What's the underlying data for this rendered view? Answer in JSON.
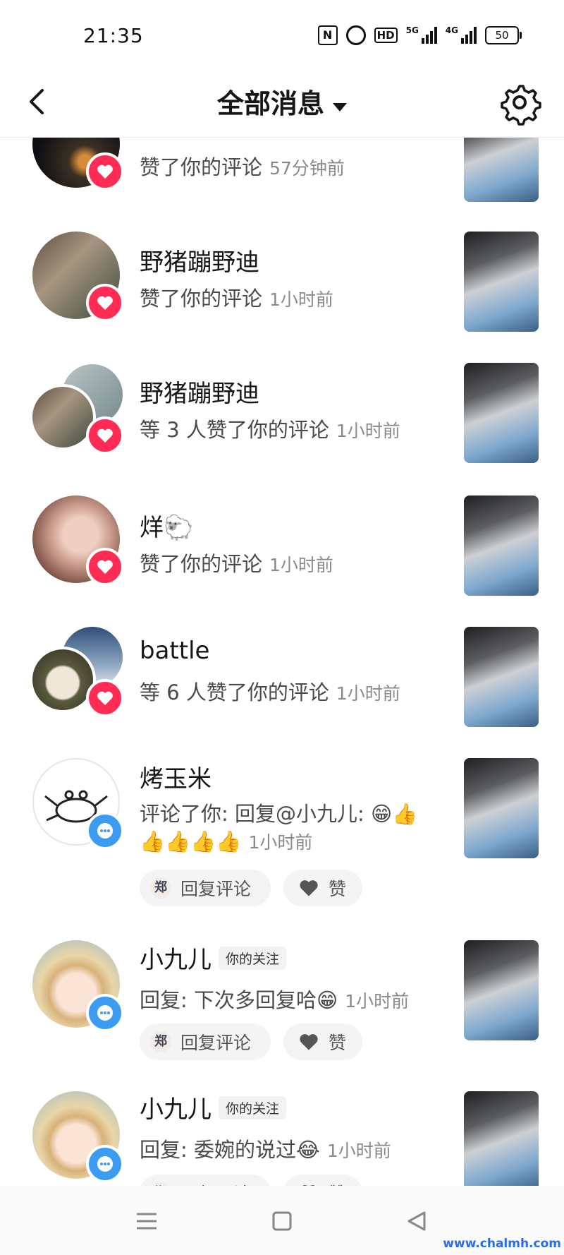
{
  "status_bar": {
    "time": "21:35",
    "hd": "HD",
    "net5g": "5G",
    "net4g": "4G",
    "battery": "50"
  },
  "header": {
    "title": "全部消息"
  },
  "items": [
    {
      "name": "",
      "desc": "赞了你的评论",
      "time": "57分钟前"
    },
    {
      "name": "野猪蹦野迪",
      "desc": "赞了你的评论",
      "time": "1小时前"
    },
    {
      "name": "野猪蹦野迪",
      "desc": "等 3 人赞了你的评论",
      "time": "1小时前"
    },
    {
      "name": "烊🐑",
      "desc": "赞了你的评论",
      "time": "1小时前"
    },
    {
      "name": "battle",
      "desc": "等 6 人赞了你的评论",
      "time": "1小时前"
    },
    {
      "name": "烤玉米",
      "desc_line1": "评论了你: 回复@小九儿: 😁👍",
      "desc_line2": "👍👍👍👍",
      "time": "1小时前"
    },
    {
      "name": "小九儿",
      "tag": "你的关注",
      "desc": "回复: 下次多回复哈😁",
      "time": "1小时前"
    },
    {
      "name": "小九儿",
      "tag": "你的关注",
      "desc": "回复: 委婉的说过😂",
      "time": "1小时前"
    }
  ],
  "actions": {
    "reply": "回复评论",
    "like": "赞",
    "mini_avatar_char": "郑"
  },
  "watermark": "www.chalmh.com"
}
